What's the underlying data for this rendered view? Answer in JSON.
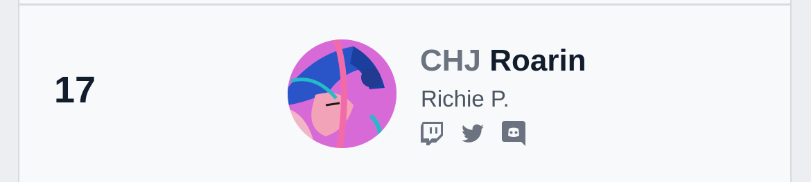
{
  "entry": {
    "rank": "17",
    "team_tag": "CHJ",
    "handle": "Roarin",
    "real_name": "Richie P.",
    "avatar": {
      "description_icon": "player-avatar",
      "colors": [
        "#d86ad8",
        "#2a55c9",
        "#f3a3b8",
        "#22bcc8"
      ]
    },
    "socials": [
      {
        "icon": "twitch-icon"
      },
      {
        "icon": "twitter-icon"
      },
      {
        "icon": "discord-icon"
      }
    ]
  },
  "colors": {
    "rank_text": "#111d2c",
    "team_text": "#6b7280",
    "name_text": "#111d2c",
    "icon": "#6b7280",
    "card_bg": "#f8f9fb",
    "border": "#d7dade"
  }
}
